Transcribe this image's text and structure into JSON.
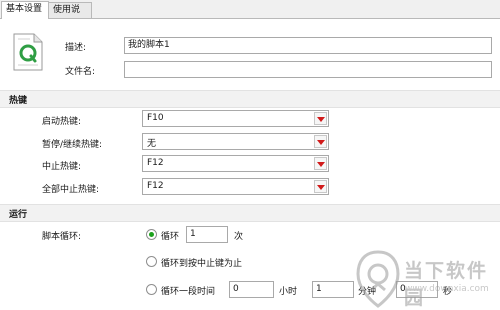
{
  "tabs": [
    "基本设置",
    "使用说明"
  ],
  "script": {
    "desc_label": "描述:",
    "desc_value": "我的脚本1",
    "file_label": "文件名:",
    "file_value": ""
  },
  "hotkeys": {
    "section_title": "热键",
    "rows": [
      {
        "label": "启动热键:",
        "value": "F10"
      },
      {
        "label": "暂停/继续热键:",
        "value": "无"
      },
      {
        "label": "中止热键:",
        "value": "F12"
      },
      {
        "label": "全部中止热键:",
        "value": "F12"
      }
    ]
  },
  "run": {
    "section_title": "运行",
    "loop_label": "脚本循环:",
    "opt_loop": "循环",
    "loop_count": "1",
    "loop_unit": "次",
    "opt_until_stop": "循环到按中止键为止",
    "opt_duration": "循环一段时间",
    "dur_hours": "0",
    "unit_hours": "小时",
    "dur_minutes": "1",
    "unit_minutes": "分钟",
    "dur_seconds": "0",
    "unit_seconds": "秒",
    "selected": "loop"
  },
  "watermark": {
    "title": "当下软件园",
    "subtitle": "www.downxia.com"
  },
  "colors": {
    "accent_green": "#1ca11c",
    "arrow_red": "#d11a1a",
    "section_bg": "#f2f2f2"
  }
}
